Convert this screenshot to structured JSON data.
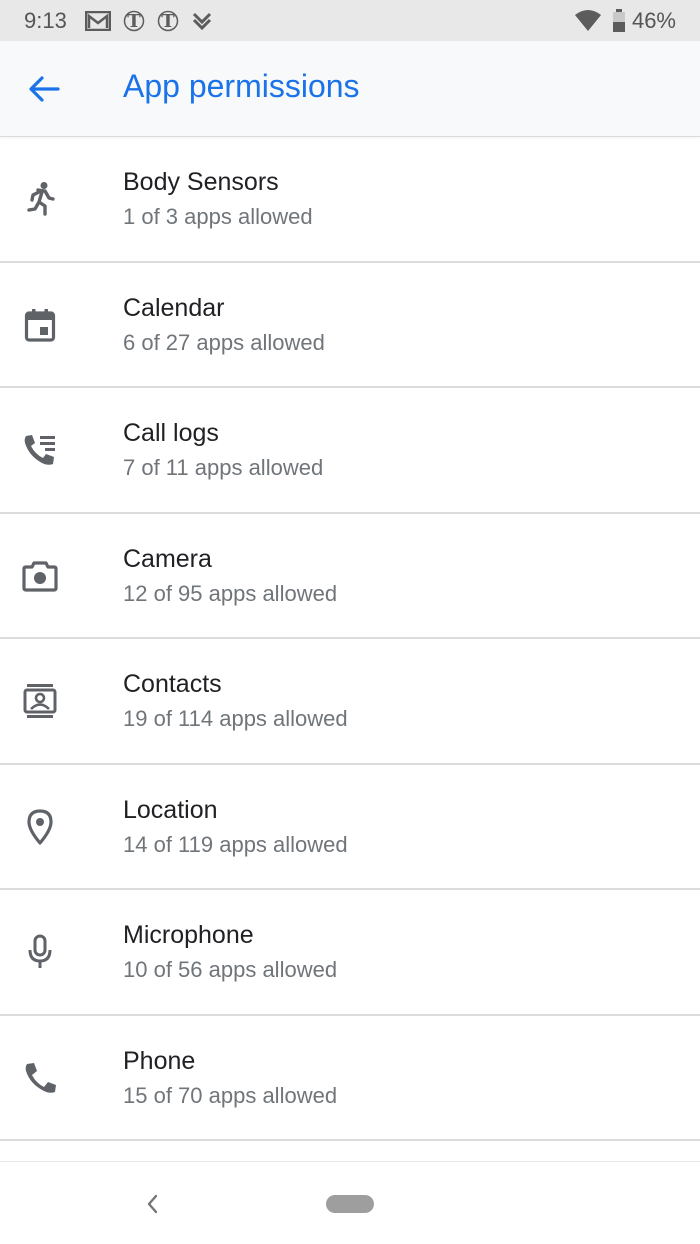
{
  "status_bar": {
    "time": "9:13",
    "notification_icons": [
      "gmail-icon",
      "nytimes-icon",
      "nytimes-icon",
      "feedly-icon"
    ],
    "battery": "46%"
  },
  "app_bar": {
    "title": "App permissions",
    "accent_color": "#1a73e8"
  },
  "permissions": [
    {
      "label": "Body Sensors",
      "status": "1 of 3 apps allowed",
      "icon": "body-sensors-icon"
    },
    {
      "label": "Calendar",
      "status": "6 of 27 apps allowed",
      "icon": "calendar-icon"
    },
    {
      "label": "Call logs",
      "status": "7 of 11 apps allowed",
      "icon": "call-logs-icon"
    },
    {
      "label": "Camera",
      "status": "12 of 95 apps allowed",
      "icon": "camera-icon"
    },
    {
      "label": "Contacts",
      "status": "19 of 114 apps allowed",
      "icon": "contacts-icon"
    },
    {
      "label": "Location",
      "status": "14 of 119 apps allowed",
      "icon": "location-icon"
    },
    {
      "label": "Microphone",
      "status": "10 of 56 apps allowed",
      "icon": "microphone-icon"
    },
    {
      "label": "Phone",
      "status": "15 of 70 apps allowed",
      "icon": "phone-icon"
    }
  ]
}
